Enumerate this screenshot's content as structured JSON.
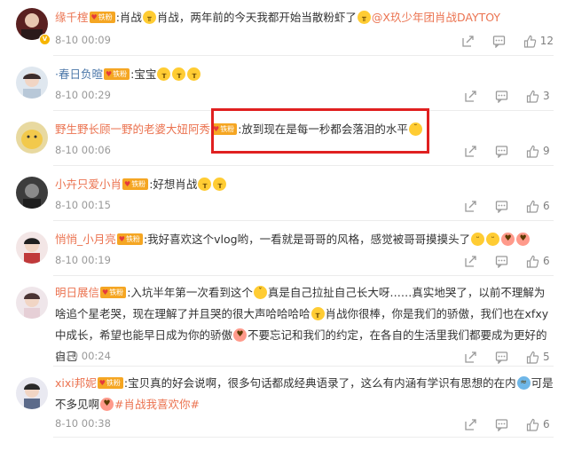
{
  "comments": [
    {
      "user": "缘千榁",
      "badge": "铁粉",
      "segments": [
        ":肖战",
        "肖战，两年前的今天我都开始当散粉虾了",
        "@X玖少年团肖战DAYTOY"
      ],
      "time": "8-10 00:09",
      "likes": "12"
    },
    {
      "user": "·春日负暄",
      "badge": "铁粉",
      "segments": [
        ":宝宝"
      ],
      "time": "8-10 00:29",
      "likes": "3"
    },
    {
      "user": "野生野长顾一野的老婆大妞阿秀",
      "badge": "铁粉",
      "segments": [
        ":放到现在是每一秒都会落泪的水平"
      ],
      "time": "8-10 00:06",
      "likes": "9"
    },
    {
      "user": "小卉只爱小肖",
      "badge": "铁粉",
      "segments": [
        ":好想肖战"
      ],
      "time": "8-10 00:15",
      "likes": "6"
    },
    {
      "user": "悄悄_小月亮",
      "badge": "铁粉",
      "segments": [
        ":我好喜欢这个vlog哟，一看就是哥哥的风格，感觉被哥哥摸摸头了"
      ],
      "time": "8-10 00:19",
      "likes": "6"
    },
    {
      "user": "明日展信",
      "badge": "铁粉",
      "segments": [
        ":入坑半年第一次看到这个",
        "真是自己拉扯自己长大呀……真实地哭了，以前不理解为啥追个星老哭，现在理解了并且哭的很大声哈哈哈哈",
        "肖战你很棒，你是我们的骄傲，我们也在xfxy中成长，希望也能早日成为你的骄傲",
        "不要忘记和我们的约定，在各自的生活里我们都要成为更好的自己"
      ],
      "time": "8-10 00:24",
      "likes": "5"
    },
    {
      "user": "xixi邦妮",
      "badge": "铁粉",
      "segments": [
        ":宝贝真的好会说啊，很多句话都成经典语录了，这么有内涵有学识有思想的在内",
        "可是不多见啊",
        "#肖战我喜欢你#"
      ],
      "time": "8-10 00:38",
      "likes": "6"
    }
  ],
  "colors": {
    "username": "#eb7350",
    "meta": "#999999",
    "badge": "#f5a623",
    "highlight": "#e02020"
  },
  "icons": [
    "share-icon",
    "comment-icon",
    "like-icon"
  ]
}
